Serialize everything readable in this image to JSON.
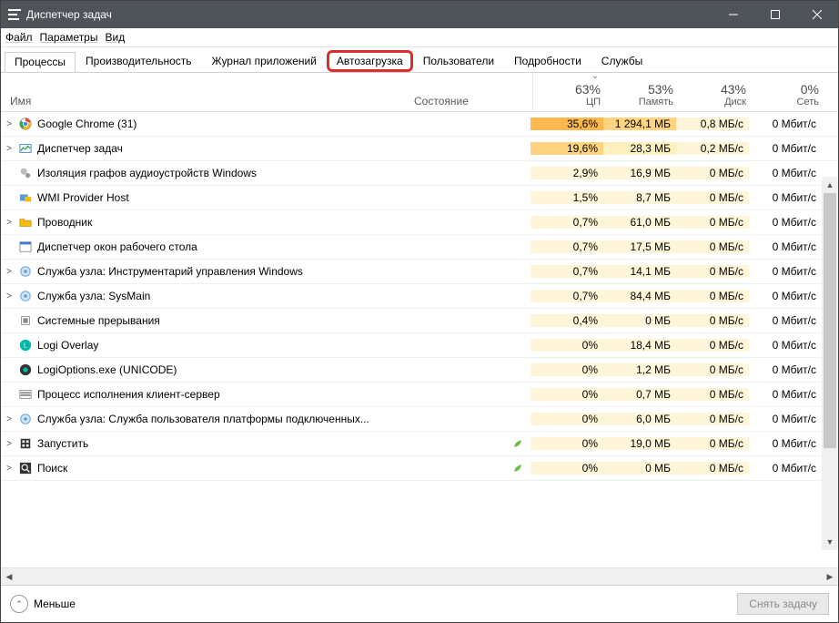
{
  "window": {
    "title": "Диспетчер задач"
  },
  "menu": {
    "file": "Файл",
    "options": "Параметры",
    "view": "Вид"
  },
  "tabs": {
    "processes": "Процессы",
    "performance": "Производительность",
    "app_history": "Журнал приложений",
    "startup": "Автозагрузка",
    "users": "Пользователи",
    "details": "Подробности",
    "services": "Службы"
  },
  "columns": {
    "name": "Имя",
    "state": "Состояние",
    "cpu_pct": "63%",
    "cpu_label": "ЦП",
    "mem_pct": "53%",
    "mem_label": "Память",
    "disk_pct": "43%",
    "disk_label": "Диск",
    "net_pct": "0%",
    "net_label": "Сеть"
  },
  "rows": [
    {
      "expand": true,
      "icon": "chrome",
      "name": "Google Chrome (31)",
      "cpu": "35,6%",
      "mem": "1 294,1 МБ",
      "disk": "0,8 МБ/с",
      "net": "0 Мбит/с",
      "heat": 1,
      "memhot": true
    },
    {
      "expand": true,
      "icon": "taskmgr",
      "name": "Диспетчер задач",
      "cpu": "19,6%",
      "mem": "28,3 МБ",
      "disk": "0,2 МБ/с",
      "net": "0 Мбит/с",
      "heat": 2
    },
    {
      "expand": false,
      "icon": "gears",
      "name": "Изоляция графов аудиоустройств Windows",
      "cpu": "2,9%",
      "mem": "16,9 МБ",
      "disk": "0 МБ/с",
      "net": "0 Мбит/с"
    },
    {
      "expand": false,
      "icon": "wmi",
      "name": "WMI Provider Host",
      "cpu": "1,5%",
      "mem": "8,7 МБ",
      "disk": "0 МБ/с",
      "net": "0 Мбит/с"
    },
    {
      "expand": true,
      "icon": "explorer",
      "name": "Проводник",
      "cpu": "0,7%",
      "mem": "61,0 МБ",
      "disk": "0 МБ/с",
      "net": "0 Мбит/с"
    },
    {
      "expand": false,
      "icon": "dwm",
      "name": "Диспетчер окон рабочего стола",
      "cpu": "0,7%",
      "mem": "17,5 МБ",
      "disk": "0 МБ/с",
      "net": "0 Мбит/с"
    },
    {
      "expand": true,
      "icon": "svc",
      "name": "Служба узла: Инструментарий управления Windows",
      "cpu": "0,7%",
      "mem": "14,1 МБ",
      "disk": "0 МБ/с",
      "net": "0 Мбит/с"
    },
    {
      "expand": true,
      "icon": "svc",
      "name": "Служба узла: SysMain",
      "cpu": "0,7%",
      "mem": "84,4 МБ",
      "disk": "0 МБ/с",
      "net": "0 Мбит/с"
    },
    {
      "expand": false,
      "icon": "cpu",
      "name": "Системные прерывания",
      "cpu": "0,4%",
      "mem": "0 МБ",
      "disk": "0 МБ/с",
      "net": "0 Мбит/с"
    },
    {
      "expand": false,
      "icon": "logi",
      "name": "Logi Overlay",
      "cpu": "0%",
      "mem": "18,4 МБ",
      "disk": "0 МБ/с",
      "net": "0 Мбит/с"
    },
    {
      "expand": false,
      "icon": "logi2",
      "name": "LogiOptions.exe (UNICODE)",
      "cpu": "0%",
      "mem": "1,2 МБ",
      "disk": "0 МБ/с",
      "net": "0 Мбит/с"
    },
    {
      "expand": false,
      "icon": "csrss",
      "name": "Процесс исполнения клиент-сервер",
      "cpu": "0%",
      "mem": "0,7 МБ",
      "disk": "0 МБ/с",
      "net": "0 Мбит/с"
    },
    {
      "expand": true,
      "icon": "svc",
      "name": "Служба узла: Служба пользователя платформы подключенных...",
      "cpu": "0%",
      "mem": "6,0 МБ",
      "disk": "0 МБ/с",
      "net": "0 Мбит/с"
    },
    {
      "expand": true,
      "icon": "start",
      "name": "Запустить",
      "cpu": "0%",
      "mem": "19,0 МБ",
      "disk": "0 МБ/с",
      "net": "0 Мбит/с",
      "leaf": true
    },
    {
      "expand": true,
      "icon": "search",
      "name": "Поиск",
      "cpu": "0%",
      "mem": "0 МБ",
      "disk": "0 МБ/с",
      "net": "0 Мбит/с",
      "leaf": true
    }
  ],
  "footer": {
    "less": "Меньше",
    "end_task": "Снять задачу"
  }
}
